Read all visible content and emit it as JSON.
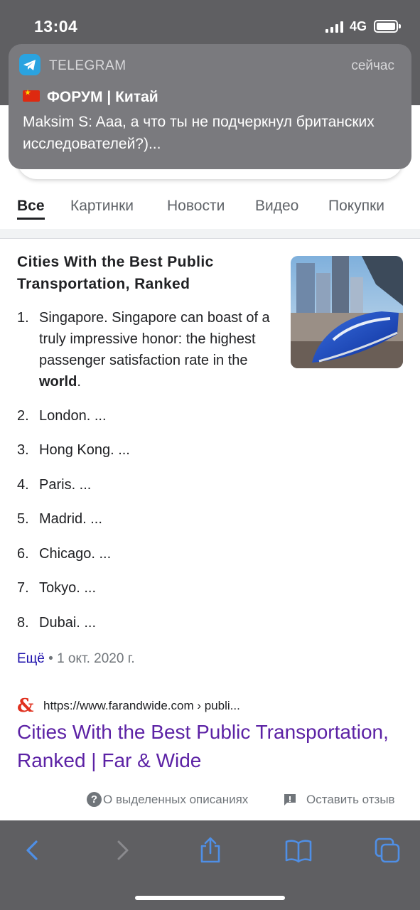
{
  "status_bar": {
    "time": "13:04",
    "network": "4G"
  },
  "notification": {
    "app": "TELEGRAM",
    "time": "сейчас",
    "title": "ФОРУМ | Китай",
    "body": "Maksim S: Aaa, а что ты не подчеркнул британских исследователей?)..."
  },
  "tabs": [
    {
      "label": "Все",
      "active": true
    },
    {
      "label": "Картинки"
    },
    {
      "label": "Новости"
    },
    {
      "label": "Видео"
    },
    {
      "label": "Покупки"
    }
  ],
  "snippet": {
    "title": "Cities With the Best Public Transportation, Ranked",
    "items": [
      {
        "num": "1.",
        "text": "Singapore. Singapore can boast of a truly impressive honor: the highest passenger satisfaction rate in the ",
        "bold": "world",
        "tail": "."
      },
      {
        "num": "2.",
        "text": "London. ..."
      },
      {
        "num": "3.",
        "text": "Hong Kong. ..."
      },
      {
        "num": "4.",
        "text": "Paris. ..."
      },
      {
        "num": "5.",
        "text": "Madrid. ..."
      },
      {
        "num": "6.",
        "text": "Chicago. ..."
      },
      {
        "num": "7.",
        "text": "Tokyo. ..."
      },
      {
        "num": "8.",
        "text": "Dubai. ..."
      }
    ],
    "more_label": "Ещё",
    "date": " • 1 окт. 2020 г.",
    "source_icon": "&",
    "source_url": "https://www.farandwide.com › publi...",
    "link_title": "Cities With the Best Public Transportation, Ranked | Far & Wide"
  },
  "footer": {
    "about_label": "О выделенных описаниях",
    "feedback_label": "Оставить отзыв"
  },
  "icons": {
    "back": "chevron-left-icon",
    "forward": "chevron-right-icon",
    "share": "share-icon",
    "bookmarks": "book-icon",
    "tabs": "tabs-icon"
  },
  "colors": {
    "link": "#5c22a5",
    "more": "#1a0dab",
    "toolbar": "#5f5f62",
    "toolbar_icon": "#4f8fe6"
  }
}
